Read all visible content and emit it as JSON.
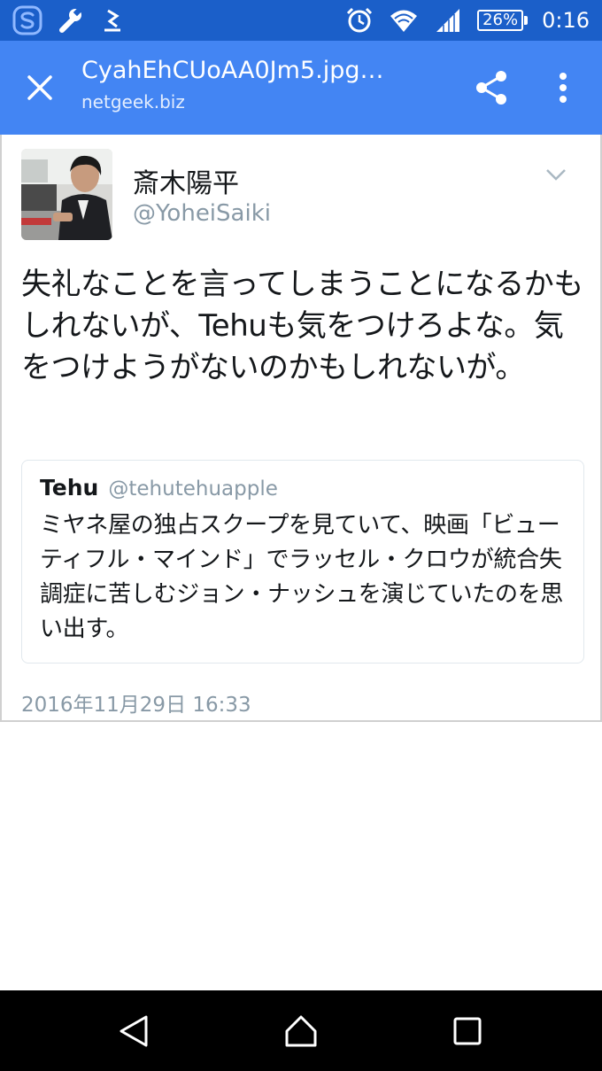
{
  "status_bar": {
    "icons_left": [
      "s-app-icon",
      "wrench-icon",
      "download-icon"
    ],
    "icons_right": [
      "alarm-icon",
      "wifi-icon",
      "signal-icon"
    ],
    "battery": "26%",
    "time": "0:16",
    "background": "#1b5fc9"
  },
  "app_bar": {
    "title": "CyahEhCUoAA0Jm5.jpg…",
    "subtitle": "netgeek.biz",
    "background": "#4385f3",
    "icons": [
      "close-icon",
      "share-icon",
      "more-vert-icon"
    ]
  },
  "tweet": {
    "author_name": "斎木陽平",
    "author_handle": "@YoheiSaiki",
    "text": "失礼なことを言ってしまうことになるかもしれないが、Tehuも気をつけろよな。気をつけようがないのかもしれないが。",
    "quote": {
      "name": "Tehu",
      "handle": "@tehutehuapple",
      "text": "ミヤネ屋の独占スクープを見ていて、映画「ビューティフル・マインド」でラッセル・クロウが統合失調症に苦しむジョン・ナッシュを演じていたのを思い出す。"
    },
    "timestamp": "2016年11月29日 16:33"
  },
  "nav_bar": {
    "icons": [
      "back-icon",
      "home-icon",
      "recents-icon"
    ]
  }
}
